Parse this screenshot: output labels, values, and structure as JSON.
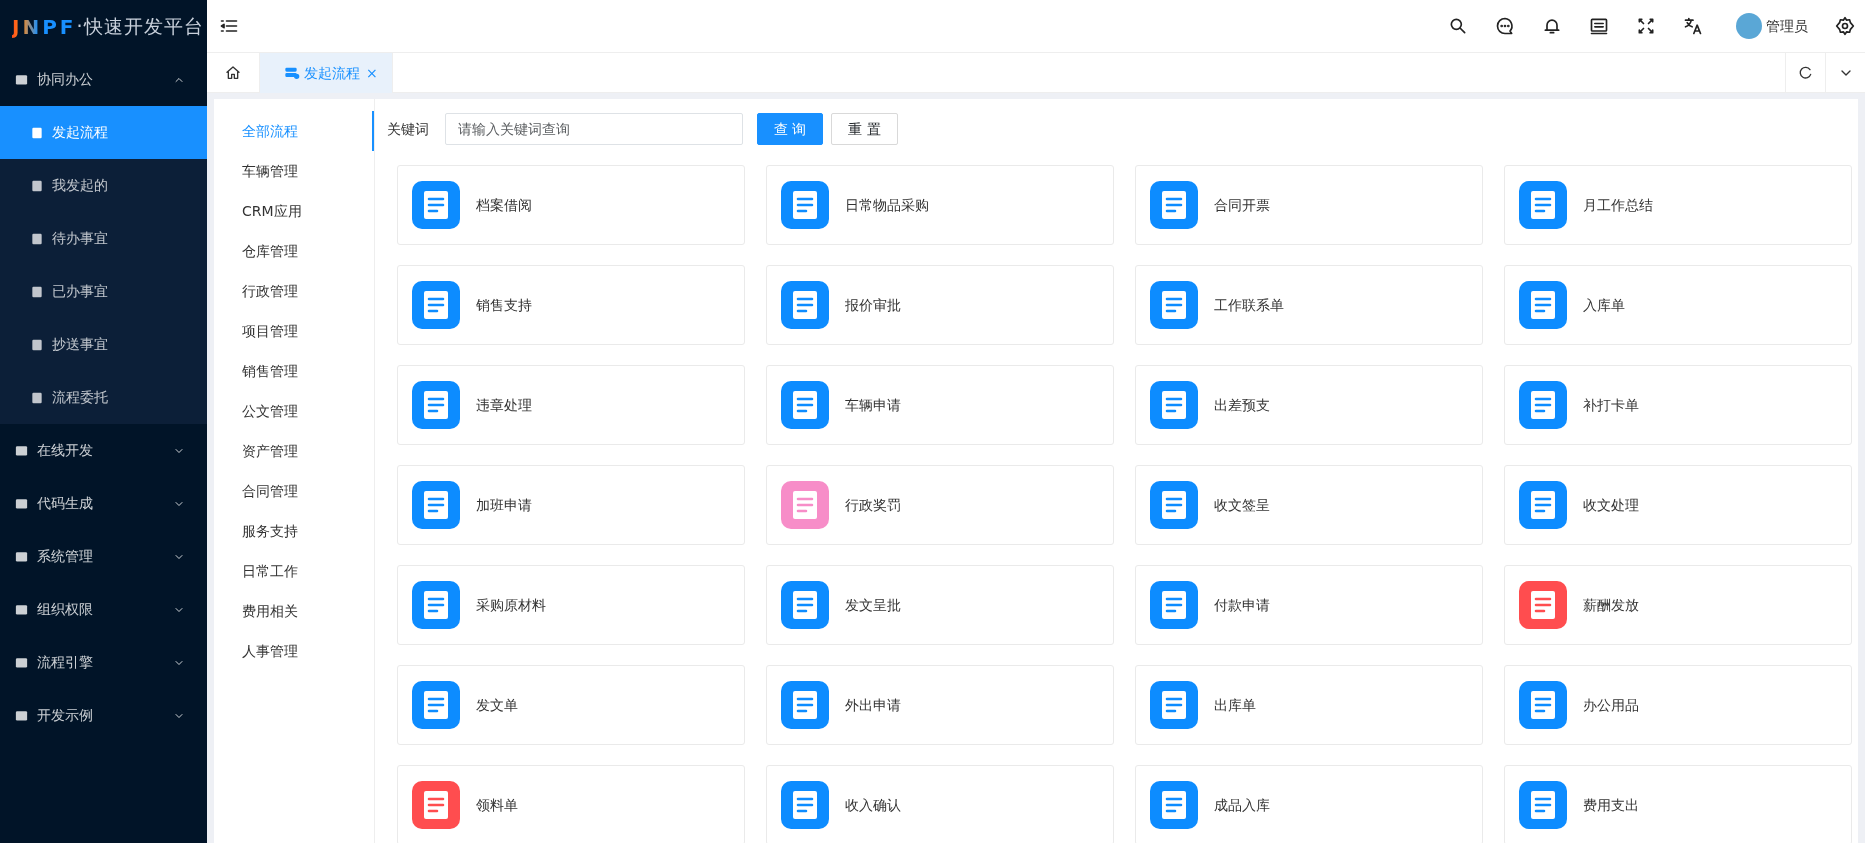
{
  "logo": {
    "brand": "JNPF",
    "title": "·快速开发平台"
  },
  "sidebar": {
    "groups": [
      {
        "label": "协同办公",
        "expanded": true,
        "children": [
          {
            "label": "发起流程",
            "selected": true
          },
          {
            "label": "我发起的",
            "selected": false
          },
          {
            "label": "待办事宜",
            "selected": false
          },
          {
            "label": "已办事宜",
            "selected": false
          },
          {
            "label": "抄送事宜",
            "selected": false
          },
          {
            "label": "流程委托",
            "selected": false
          }
        ]
      },
      {
        "label": "在线开发",
        "expanded": false
      },
      {
        "label": "代码生成",
        "expanded": false
      },
      {
        "label": "系统管理",
        "expanded": false
      },
      {
        "label": "组织权限",
        "expanded": false
      },
      {
        "label": "流程引擎",
        "expanded": false
      },
      {
        "label": "开发示例",
        "expanded": false
      }
    ]
  },
  "header": {
    "user": "管理员"
  },
  "tabs": [
    {
      "kind": "home",
      "selected": false
    },
    {
      "kind": "page",
      "label": "发起流程",
      "close": "×",
      "selected": true
    }
  ],
  "categories": [
    {
      "label": "全部流程",
      "selected": true
    },
    {
      "label": "车辆管理",
      "selected": false
    },
    {
      "label": "CRM应用",
      "selected": false
    },
    {
      "label": "仓库管理",
      "selected": false
    },
    {
      "label": "行政管理",
      "selected": false
    },
    {
      "label": "项目管理",
      "selected": false
    },
    {
      "label": "销售管理",
      "selected": false
    },
    {
      "label": "公文管理",
      "selected": false
    },
    {
      "label": "资产管理",
      "selected": false
    },
    {
      "label": "合同管理",
      "selected": false
    },
    {
      "label": "服务支持",
      "selected": false
    },
    {
      "label": "日常工作",
      "selected": false
    },
    {
      "label": "费用相关",
      "selected": false
    },
    {
      "label": "人事管理",
      "selected": false
    }
  ],
  "search": {
    "label": "关键词",
    "placeholder": "请输入关键词查询",
    "submit": "查 询",
    "reset": "重 置"
  },
  "flows": [
    {
      "label": "档案借阅",
      "color": "#0d8cff"
    },
    {
      "label": "日常物品采购",
      "color": "#0d8cff"
    },
    {
      "label": "合同开票",
      "color": "#0d8cff"
    },
    {
      "label": "月工作总结",
      "color": "#0d8cff"
    },
    {
      "label": "销售支持",
      "color": "#0d8cff"
    },
    {
      "label": "报价审批",
      "color": "#0d8cff"
    },
    {
      "label": "工作联系单",
      "color": "#0d8cff"
    },
    {
      "label": "入库单",
      "color": "#0d8cff"
    },
    {
      "label": "违章处理",
      "color": "#0d8cff"
    },
    {
      "label": "车辆申请",
      "color": "#0d8cff"
    },
    {
      "label": "出差预支",
      "color": "#0d8cff"
    },
    {
      "label": "补打卡单",
      "color": "#0d8cff"
    },
    {
      "label": "加班申请",
      "color": "#0d8cff"
    },
    {
      "label": "行政奖罚",
      "color": "#f78dc8"
    },
    {
      "label": "收文签呈",
      "color": "#0d8cff"
    },
    {
      "label": "收文处理",
      "color": "#0d8cff"
    },
    {
      "label": "采购原材料",
      "color": "#0d8cff"
    },
    {
      "label": "发文呈批",
      "color": "#0d8cff"
    },
    {
      "label": "付款申请",
      "color": "#0d8cff"
    },
    {
      "label": "薪酬发放",
      "color": "#ff4d4f"
    },
    {
      "label": "发文单",
      "color": "#0d8cff"
    },
    {
      "label": "外出申请",
      "color": "#0d8cff"
    },
    {
      "label": "出库单",
      "color": "#0d8cff"
    },
    {
      "label": "办公用品",
      "color": "#0d8cff"
    },
    {
      "label": "领料单",
      "color": "#ff4d4f"
    },
    {
      "label": "收入确认",
      "color": "#0d8cff"
    },
    {
      "label": "成品入库",
      "color": "#0d8cff"
    },
    {
      "label": "费用支出",
      "color": "#0d8cff"
    }
  ]
}
